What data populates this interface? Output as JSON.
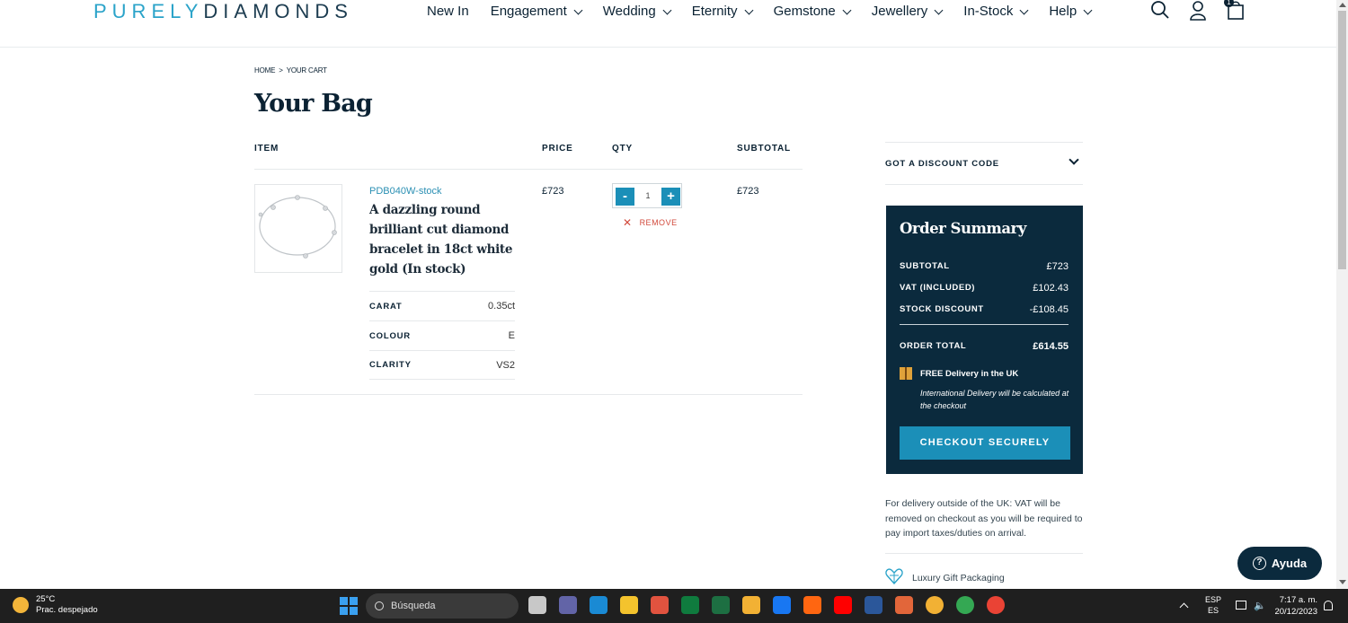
{
  "header": {
    "logo_part1": "PURELY",
    "logo_part2": "DIAMONDS",
    "nav": [
      {
        "label": "New In",
        "has_chevron": false
      },
      {
        "label": "Engagement",
        "has_chevron": true
      },
      {
        "label": "Wedding",
        "has_chevron": true
      },
      {
        "label": "Eternity",
        "has_chevron": true
      },
      {
        "label": "Gemstone",
        "has_chevron": true
      },
      {
        "label": "Jewellery",
        "has_chevron": true
      },
      {
        "label": "In-Stock",
        "has_chevron": true
      },
      {
        "label": "Help",
        "has_chevron": true
      }
    ],
    "icons": [
      "search-icon",
      "account-icon",
      "shopping-bag-icon"
    ],
    "cart_count": "1"
  },
  "breadcrumb": {
    "home": "HOME",
    "sep": ">",
    "current": "YOUR CART"
  },
  "page_title": "Your Bag",
  "table": {
    "headers": {
      "item": "ITEM",
      "price": "PRICE",
      "qty": "QTY",
      "subtotal": "SUBTOTAL"
    },
    "item": {
      "sku": "PDB040W-stock",
      "name": "A dazzling round brilliant cut diamond bracelet in 18ct white gold (In stock)",
      "specs": [
        {
          "label": "CARAT",
          "value": "0.35ct"
        },
        {
          "label": "COLOUR",
          "value": "E"
        },
        {
          "label": "CLARITY",
          "value": "VS2"
        }
      ],
      "price": "£723",
      "qty": "1",
      "minus": "-",
      "plus": "+",
      "remove": "REMOVE",
      "subtotal": "£723"
    }
  },
  "discount": {
    "label": "GOT A DISCOUNT CODE"
  },
  "summary": {
    "title": "Order Summary",
    "rows": [
      {
        "label": "SUBTOTAL",
        "value": "£723"
      },
      {
        "label": "VAT (INCLUDED)",
        "value": "£102.43"
      },
      {
        "label": "STOCK DISCOUNT",
        "value": "-£108.45"
      }
    ],
    "total_label": "ORDER TOTAL",
    "total_value": "£614.55",
    "free_delivery": "FREE Delivery in the UK",
    "intl_note": "International Delivery will be calculated at the checkout",
    "checkout": "CHECKOUT SECURELY"
  },
  "vat_note": "For delivery outside of the UK: VAT will be removed on checkout as you will be required to pay import taxes/duties on arrival.",
  "gift": "Luxury Gift Packaging",
  "help_button": "Ayuda",
  "taskbar": {
    "temp": "25°C",
    "weather": "Prac. despejado",
    "search": "Búsqueda",
    "lang_top": "ESP",
    "lang_bottom": "ES",
    "time": "7:17 a. m.",
    "date": "20/12/2023",
    "app_colors": [
      "#c8c8c8",
      "#6264a7",
      "#1a8ad4",
      "#f4c32d",
      "#e1533f",
      "#0f7b3e",
      "#1d6f42",
      "#f2b134",
      "#1877f2",
      "#ff6611",
      "#ff0000",
      "#2b579a",
      "#e2663a",
      "#f2b134",
      "#34a853",
      "#ea4335"
    ]
  },
  "colors": {
    "accent": "#1b8fb8",
    "navy": "#0b2a3d",
    "remove": "#d24a3c"
  }
}
